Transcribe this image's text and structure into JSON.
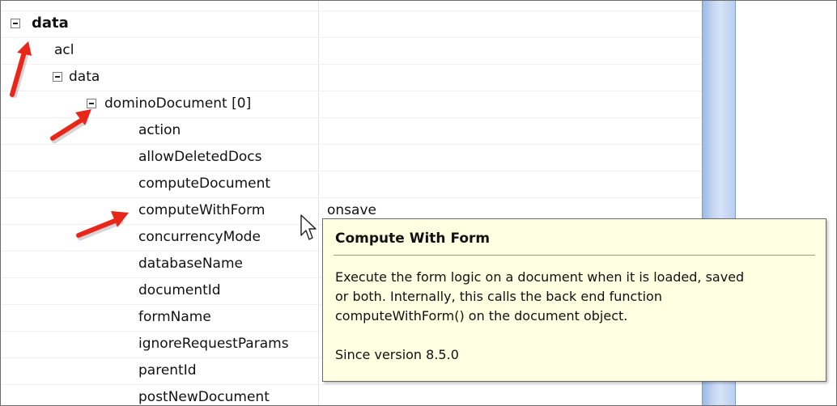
{
  "tree": {
    "rows": [
      {
        "label": "data",
        "value": ""
      },
      {
        "label": "acl",
        "value": ""
      },
      {
        "label": "data",
        "value": ""
      },
      {
        "label": "dominoDocument [0]",
        "value": ""
      },
      {
        "label": "action",
        "value": ""
      },
      {
        "label": "allowDeletedDocs",
        "value": ""
      },
      {
        "label": "computeDocument",
        "value": ""
      },
      {
        "label": "computeWithForm",
        "value": "onsave"
      },
      {
        "label": "concurrencyMode",
        "value": ""
      },
      {
        "label": "databaseName",
        "value": ""
      },
      {
        "label": "documentId",
        "value": ""
      },
      {
        "label": "formName",
        "value": ""
      },
      {
        "label": "ignoreRequestParams",
        "value": ""
      },
      {
        "label": "parentId",
        "value": ""
      },
      {
        "label": "postNewDocument",
        "value": ""
      }
    ]
  },
  "tooltip": {
    "title": "Compute With Form",
    "line1": "Execute the form logic on a document when it is loaded, saved",
    "line2": "or both. Internally, this calls the back end function",
    "line3": "computeWithForm() on the document object.",
    "since": "Since version 8.5.0"
  },
  "colors": {
    "arrow": "#e8261a",
    "tooltip_bg": "#ffffe1",
    "scrollbar": "#c7d8f3"
  },
  "icons": [
    "collapse-icon",
    "pointer-cursor-icon",
    "red-arrow-annotation"
  ]
}
